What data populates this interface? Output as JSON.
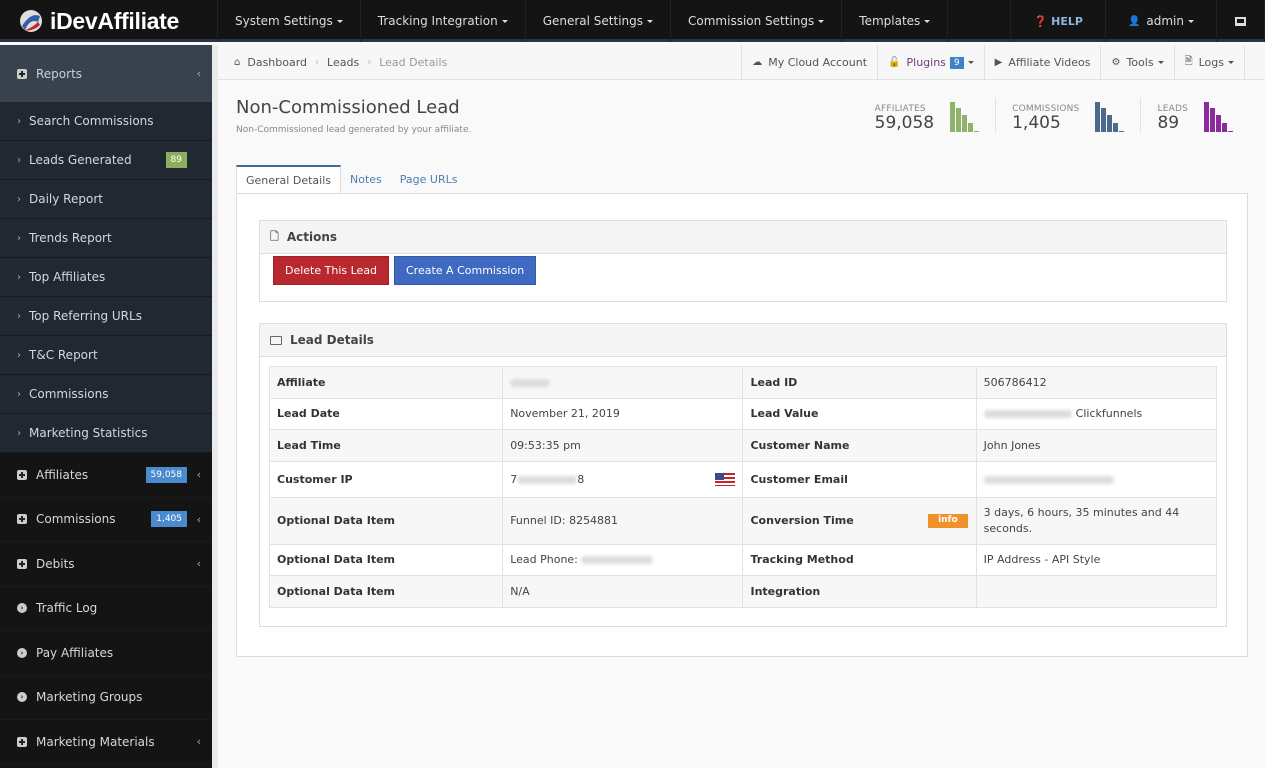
{
  "app": {
    "name": "iDevAffiliate"
  },
  "topnav": {
    "items": [
      "System Settings",
      "Tracking Integration",
      "General Settings",
      "Commission Settings",
      "Templates"
    ],
    "help": "HELP",
    "user": "admin"
  },
  "sidebar": {
    "header": "Reports",
    "sub_items": [
      {
        "label": "Search Commissions"
      },
      {
        "label": "Leads Generated",
        "badge": "89"
      },
      {
        "label": "Daily Report"
      },
      {
        "label": "Trends Report"
      },
      {
        "label": "Top Affiliates"
      },
      {
        "label": "Top Referring URLs"
      },
      {
        "label": "T&C Report"
      },
      {
        "label": "Commissions"
      },
      {
        "label": "Marketing Statistics"
      }
    ],
    "main_items": [
      {
        "label": "Affiliates",
        "badge": "59,058",
        "icon": "plus-square-icon"
      },
      {
        "label": "Commissions",
        "badge": "1,405",
        "icon": "plus-square-icon"
      },
      {
        "label": "Debits",
        "icon": "plus-square-icon"
      },
      {
        "label": "Traffic Log",
        "icon": "chevron-circle-icon"
      },
      {
        "label": "Pay Affiliates",
        "icon": "chevron-circle-icon"
      },
      {
        "label": "Marketing Groups",
        "icon": "chevron-circle-icon"
      },
      {
        "label": "Marketing Materials",
        "icon": "plus-square-icon"
      }
    ]
  },
  "breadcrumb": [
    "Dashboard",
    "Leads",
    "Lead Details"
  ],
  "tools": {
    "cloud": "My Cloud Account",
    "plugins": "Plugins",
    "plugins_count": "9",
    "videos": "Affiliate Videos",
    "tools": "Tools",
    "logs": "Logs"
  },
  "page": {
    "title": "Non-Commissioned Lead",
    "subtitle": "Non-Commissioned lead generated by your affiliate."
  },
  "stats": [
    {
      "label": "AFFILIATES",
      "value": "59,058",
      "color": "#8fb26a"
    },
    {
      "label": "COMMISSIONS",
      "value": "1,405",
      "color": "#4d6a8c"
    },
    {
      "label": "LEADS",
      "value": "89",
      "color": "#8b2a9c"
    }
  ],
  "tabs": [
    "General Details",
    "Notes",
    "Page URLs"
  ],
  "actions": {
    "title": "Actions",
    "delete": "Delete This Lead",
    "create": "Create A Commission"
  },
  "details": {
    "title": "Lead Details",
    "rows": [
      {
        "k1": "Affiliate",
        "v1": "",
        "k2": "Lead ID",
        "v2": "506786412"
      },
      {
        "k1": "Lead Date",
        "v1": "November 21, 2019",
        "k2": "Lead Value",
        "v2": "Clickfunnels"
      },
      {
        "k1": "Lead Time",
        "v1": "09:53:35 pm",
        "k2": "Customer Name",
        "v2": "John Jones"
      },
      {
        "k1": "Customer IP",
        "v1": "7",
        "v1b": "8",
        "k2": "Customer Email",
        "v2": ""
      },
      {
        "k1": "Optional Data Item",
        "v1": "Funnel ID: 8254881",
        "k2": "Conversion Time",
        "v2": "3 days, 6 hours, 35 minutes and 44 seconds.",
        "badge": "info"
      },
      {
        "k1": "Optional Data Item",
        "v1": "Lead Phone:",
        "k2": "Tracking Method",
        "v2": "IP Address - API Style"
      },
      {
        "k1": "Optional Data Item",
        "v1": "N/A",
        "k2": "Integration",
        "v2": ""
      }
    ]
  }
}
